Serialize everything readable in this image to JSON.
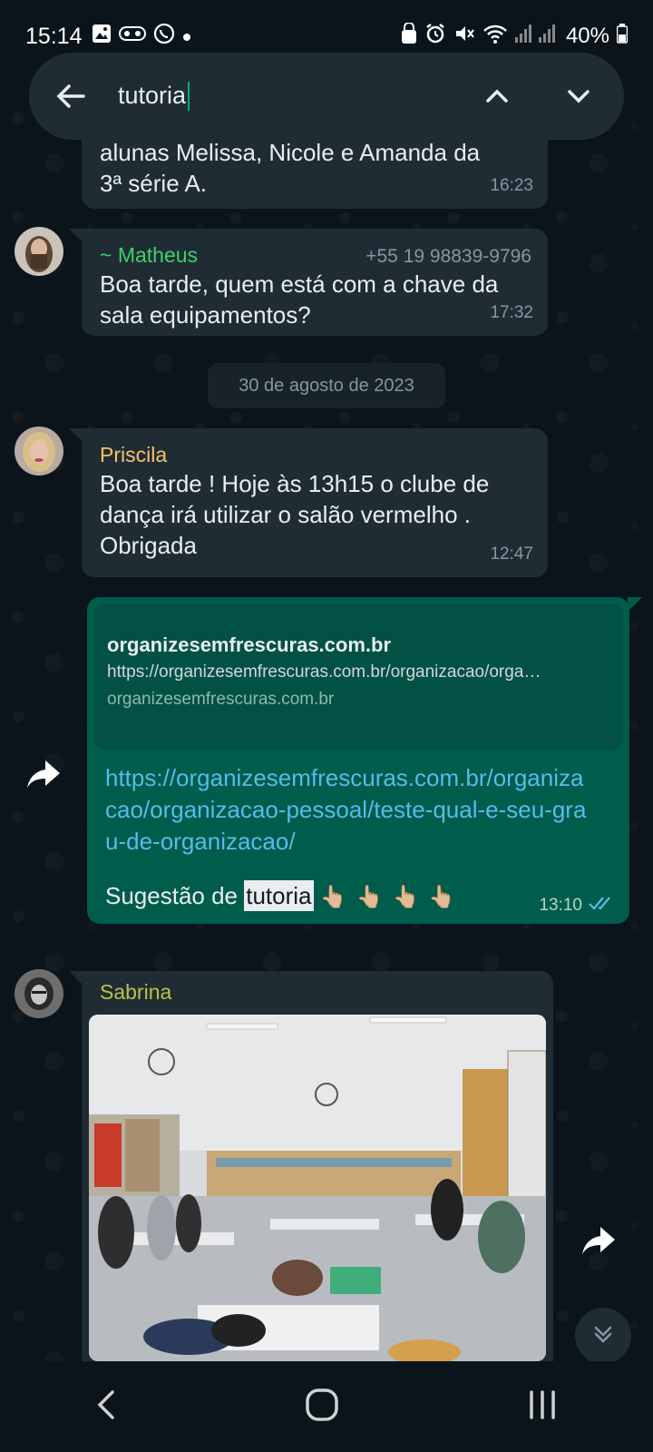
{
  "status_bar": {
    "time": "15:14",
    "battery": "40%"
  },
  "search": {
    "query": "tutoria"
  },
  "messages": {
    "partial": {
      "line1": "alunas Melissa, Nicole e Amanda da",
      "line2": "3ª série A.",
      "time": "16:23"
    },
    "matheus": {
      "sender": "~ Matheus",
      "phone": "+55 19 98839-9796",
      "text": "Boa tarde, quem está com a chave da sala equipamentos?",
      "time": "17:32"
    },
    "date_divider": "30 de agosto de 2023",
    "priscila": {
      "sender": "Priscila",
      "text": "Boa tarde ! Hoje às 13h15 o clube de dança irá utilizar o salão vermelho . Obrigada",
      "time": "12:47"
    },
    "outgoing": {
      "preview_title": "organizesemfrescuras.com.br",
      "preview_url": "https://organizesemfrescuras.com.br/organizacao/orga…",
      "preview_domain": "organizesemfrescuras.com.br",
      "link": "https://organizesemfrescuras.com.br/organizacao/organizacao-pessoal/teste-qual-e-seu-grau-de-organizacao/",
      "text_before": "Sugestão de ",
      "highlight": "tutoria",
      "emojis": "👆🏼👆🏼👆🏼👆🏼",
      "time": "13:10"
    },
    "sabrina": {
      "sender": "Sabrina"
    }
  },
  "colors": {
    "matheus_name": "#3ed06c",
    "priscila_name": "#f5c26b",
    "sabrina_name": "#b8c44a",
    "accent": "#00a884",
    "outgoing_bg": "#005c4b",
    "incoming_bg": "#202c33"
  }
}
